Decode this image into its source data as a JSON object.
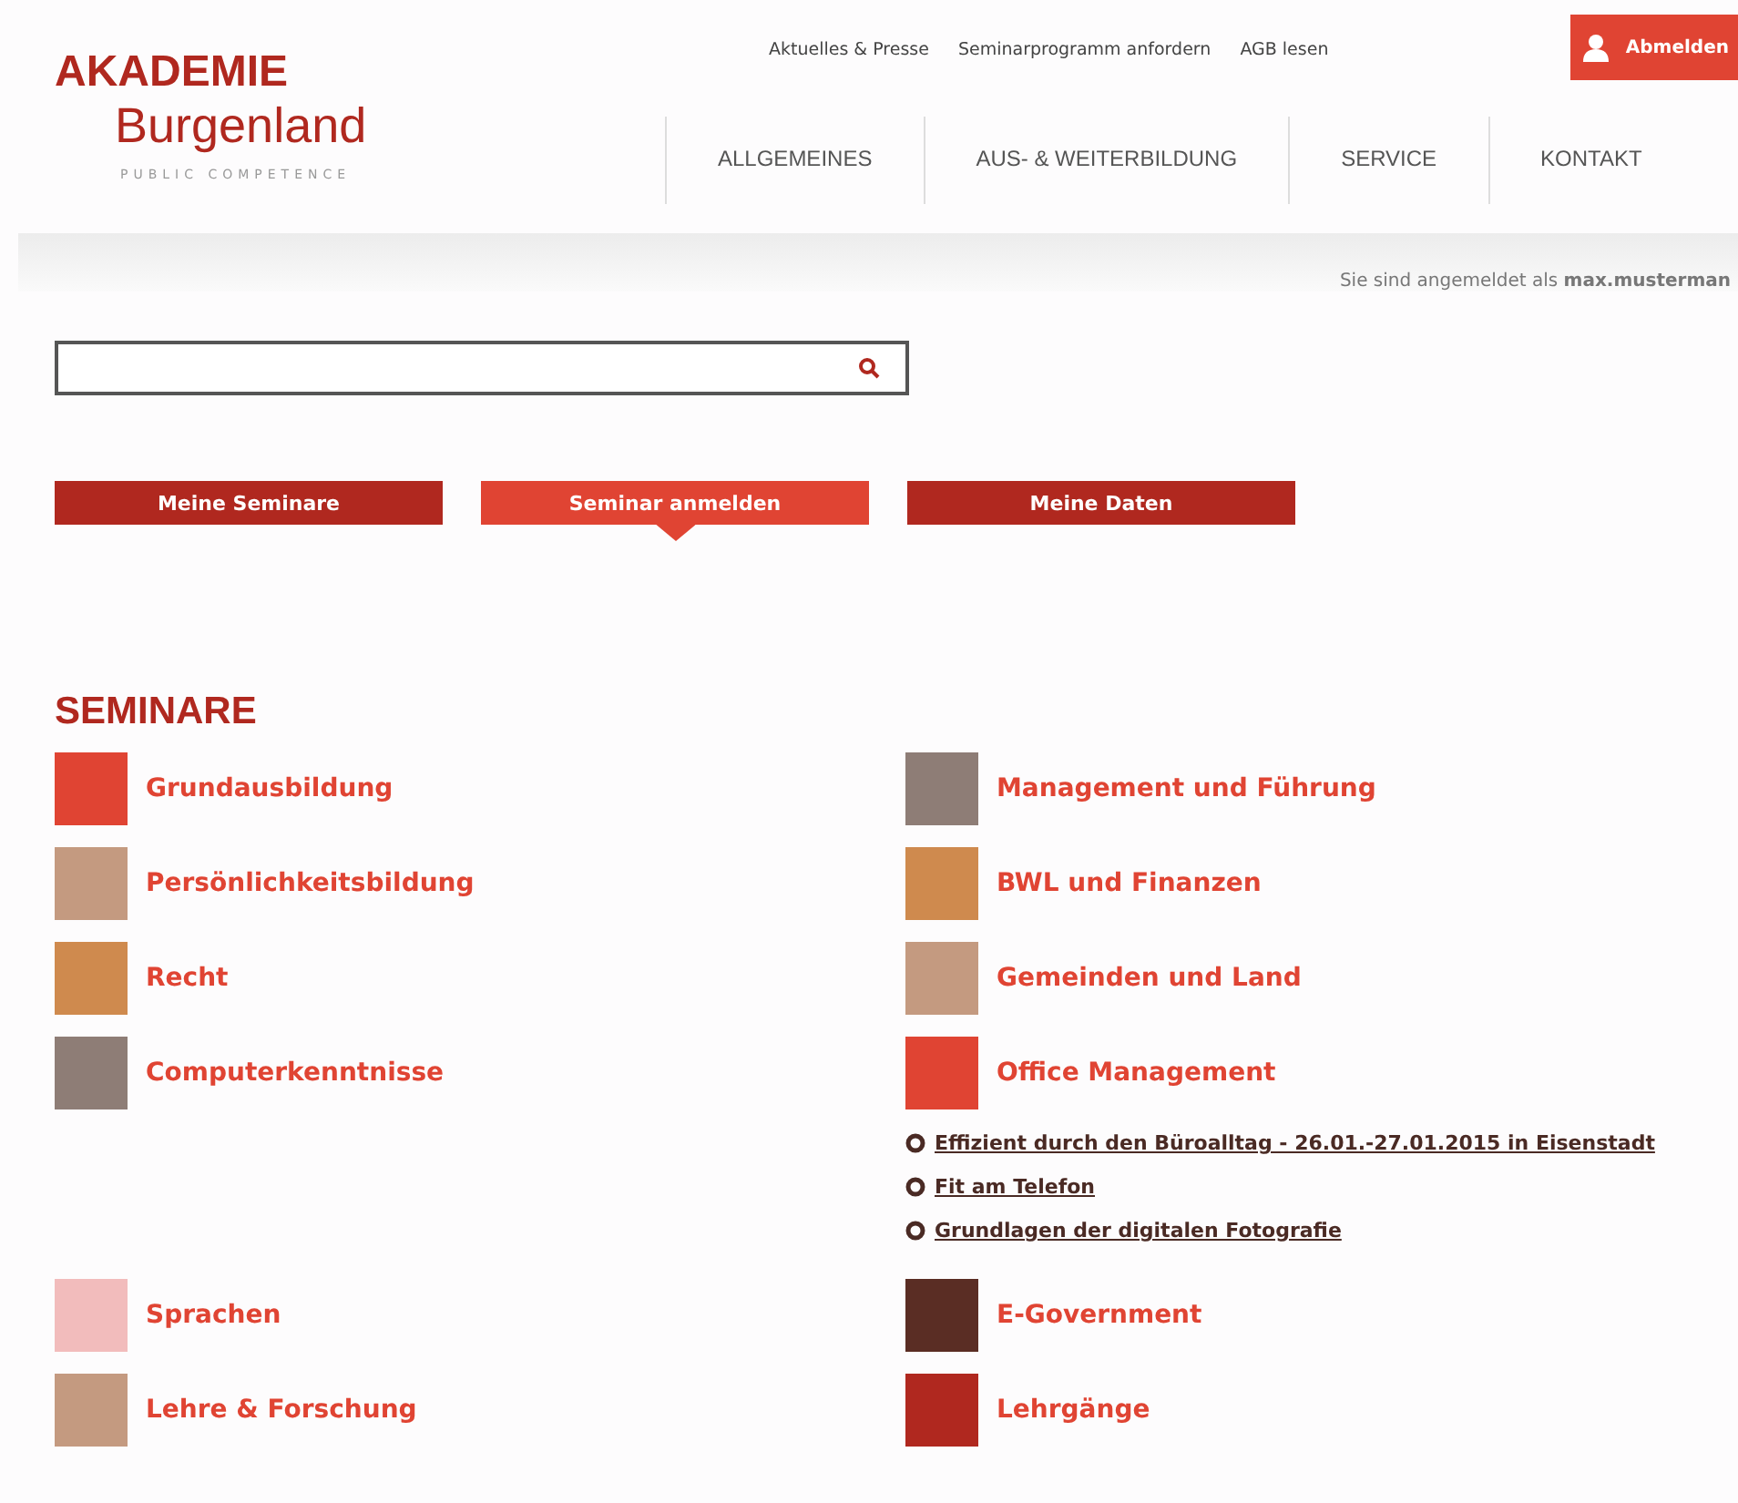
{
  "logo": {
    "line1": "AKADEMIE",
    "line2": "Burgenland",
    "tagline": "PUBLIC COMPETENCE"
  },
  "top_links": [
    "Aktuelles & Presse",
    "Seminarprogramm anfordern",
    "AGB lesen"
  ],
  "logout_button": {
    "label": "Abmelden"
  },
  "nav": [
    "ALLGEMEINES",
    "AUS- & WEITERBILDUNG",
    "SERVICE",
    "KONTAKT"
  ],
  "login_status": "Sie sind angemeldet als **max.musterman**",
  "tabs": [
    {
      "label": "Meine Seminare",
      "selected": false
    },
    {
      "label": "Seminar anmelden",
      "selected": true
    },
    {
      "label": "Meine Daten",
      "selected": false
    }
  ],
  "seminare": {
    "title": "SEMINARE",
    "rows": [
      {
        "left": {
          "label": "Grundausbildung",
          "color": "#e04433"
        },
        "right": {
          "label": "Management und Führung",
          "color": "#8e7d76"
        }
      },
      {
        "left": {
          "label": "Persönlichkeitsbildung",
          "color": "#c49a80"
        },
        "right": {
          "label": "BWL und Finanzen",
          "color": "#cf8a4e"
        }
      },
      {
        "left": {
          "label": "Recht",
          "color": "#cf8a4e"
        },
        "right": {
          "label": "Gemeinden und Land",
          "color": "#c49a80"
        }
      },
      {
        "left": {
          "label": "Computerkenntnisse",
          "color": "#8e7d76"
        },
        "right": {
          "label": "Office Management",
          "color": "#e04433",
          "links": [
            "Effizient durch den Büroalltag - 26.01.-27.01.2015 in Eisenstadt",
            "Fit am Telefon",
            "Grundlagen der digitalen Fotografie"
          ]
        }
      },
      {
        "left": {
          "label": "Sprachen",
          "color": "#f2bcbc"
        },
        "right": {
          "label": "E-Government",
          "color": "#5a2d24"
        }
      },
      {
        "left": {
          "label": "Lehre & Forschung",
          "color": "#c49a80"
        },
        "right": {
          "label": "Lehrgänge",
          "color": "#b0281f"
        }
      }
    ]
  }
}
